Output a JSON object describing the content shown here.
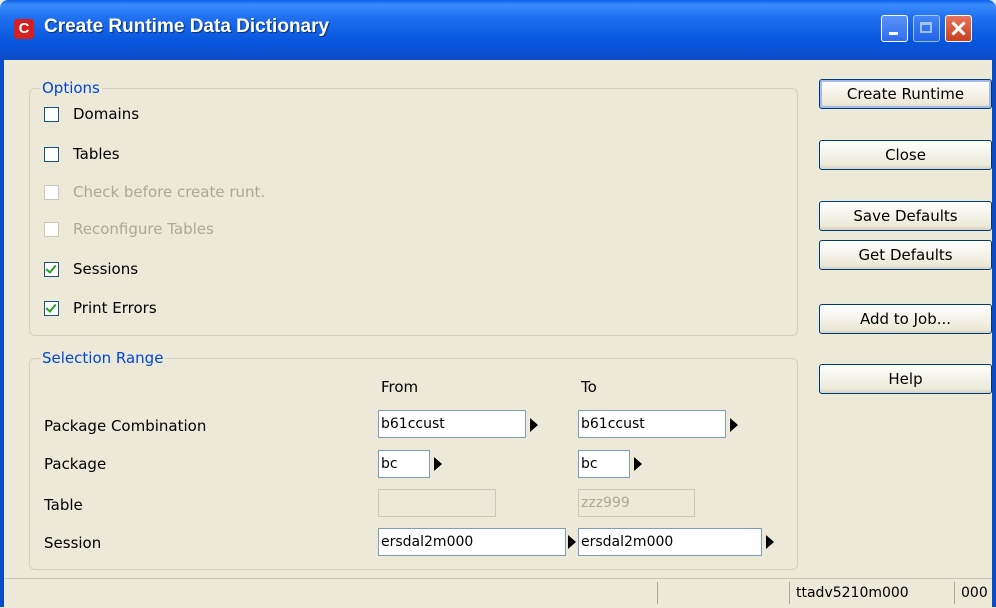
{
  "window": {
    "title": "Create Runtime Data Dictionary",
    "icon_letter": "C"
  },
  "options": {
    "title": "Options",
    "items": [
      {
        "label": "Domains",
        "checked": false,
        "enabled": true
      },
      {
        "label": "Tables",
        "checked": false,
        "enabled": true
      },
      {
        "label": "Check before create runt.",
        "checked": false,
        "enabled": false
      },
      {
        "label": "Reconfigure Tables",
        "checked": false,
        "enabled": false
      },
      {
        "label": "Sessions",
        "checked": true,
        "enabled": true
      },
      {
        "label": "Print Errors",
        "checked": true,
        "enabled": true
      }
    ]
  },
  "selection": {
    "title": "Selection Range",
    "from_header": "From",
    "to_header": "To",
    "rows": [
      {
        "label": "Package Combination",
        "from": "b61ccust",
        "to": "b61ccust"
      },
      {
        "label": "Package",
        "from": "bc",
        "to": "bc"
      },
      {
        "label": "Table",
        "from": "",
        "to": "zzz999"
      },
      {
        "label": "Session",
        "from": "ersdal2m000",
        "to": "ersdal2m000"
      }
    ]
  },
  "buttons": {
    "create_runtime": "Create Runtime",
    "close": "Close",
    "save_defaults": "Save Defaults",
    "get_defaults": "Get Defaults",
    "add_to_job": "Add to Job...",
    "help": "Help"
  },
  "statusbar": {
    "session_code": "ttadv5210m000",
    "company": "000"
  }
}
